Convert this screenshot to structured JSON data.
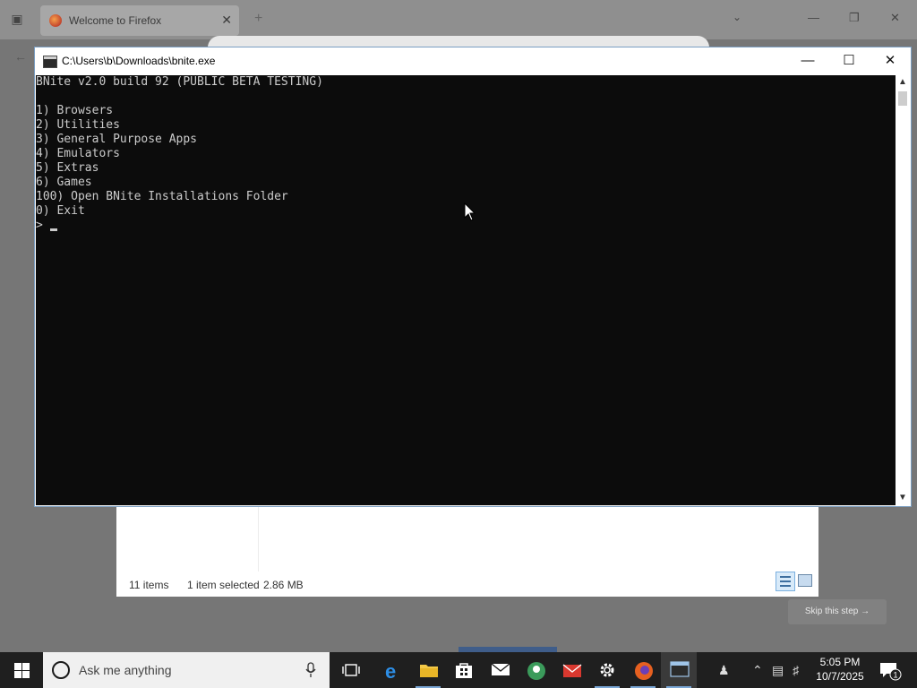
{
  "firefox": {
    "tab_title": "Welcome to Firefox",
    "skip_button": "Skip this step →"
  },
  "explorer": {
    "status_items": "11 items",
    "status_selected": "1 item selected",
    "status_size": "2.86 MB"
  },
  "console": {
    "title": "C:\\Users\\b\\Downloads\\bnite.exe",
    "lines": [
      "BNite v2.0 build 92 (PUBLIC BETA TESTING)",
      "",
      "1) Browsers",
      "2) Utilities",
      "3) General Purpose Apps",
      "4) Emulators",
      "5) Extras",
      "6) Games",
      "100) Open BNite Installations Folder",
      "0) Exit",
      ">"
    ]
  },
  "taskbar": {
    "search_placeholder": "Ask me anything",
    "apps": [
      {
        "icon": "task-view-icon"
      },
      {
        "icon": "edge-icon"
      },
      {
        "icon": "file-explorer-icon"
      },
      {
        "icon": "store-icon"
      },
      {
        "icon": "mail-icon"
      },
      {
        "icon": "maps-icon"
      },
      {
        "icon": "gitkraken-icon"
      },
      {
        "icon": "settings-icon"
      },
      {
        "icon": "firefox-icon"
      },
      {
        "icon": "console-icon"
      }
    ],
    "time": "5:05 PM",
    "date": "10/7/2025",
    "notification_count": "1"
  }
}
